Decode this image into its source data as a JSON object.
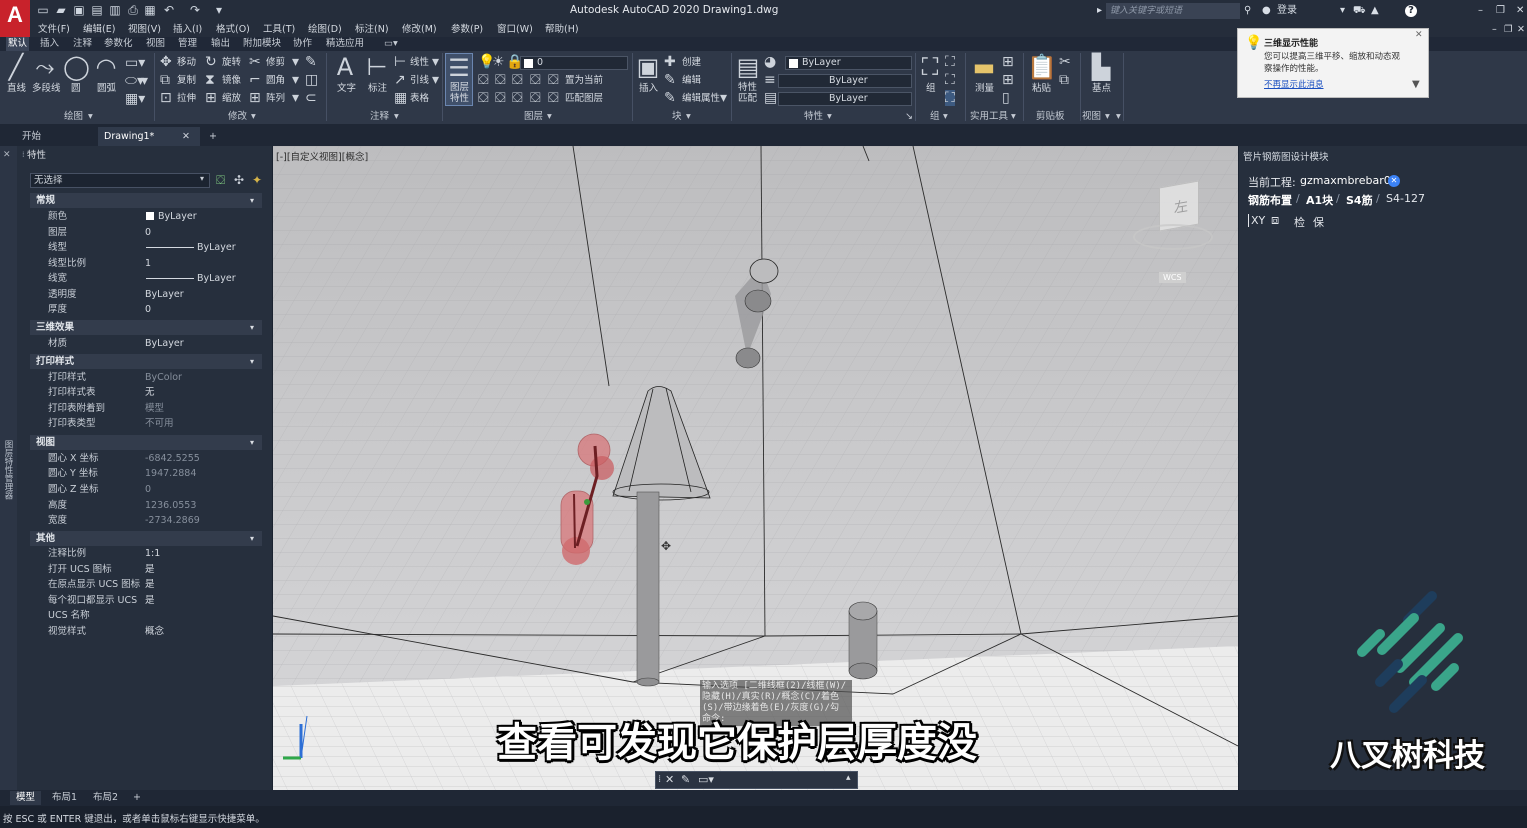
{
  "titlebar": {
    "logo": "A",
    "title": "Autodesk AutoCAD 2020    Drawing1.dwg",
    "search_placeholder": "键入关键字或短语",
    "login": "登录",
    "quick_icons": [
      "new-file-icon",
      "open-icon",
      "save-icon",
      "save-as-icon",
      "web-icon",
      "plot-icon",
      "undo-icon",
      "redo-icon"
    ],
    "window_controls": [
      "–",
      "❐",
      "✕"
    ]
  },
  "menubar": [
    "文件(F)",
    "编辑(E)",
    "视图(V)",
    "插入(I)",
    "格式(O)",
    "工具(T)",
    "绘图(D)",
    "标注(N)",
    "修改(M)",
    "参数(P)",
    "窗口(W)",
    "帮助(H)"
  ],
  "ribbon_tabs": [
    "默认",
    "插入",
    "注释",
    "参数化",
    "视图",
    "管理",
    "输出",
    "附加模块",
    "协作",
    "精选应用"
  ],
  "ribbon": {
    "draw": {
      "title": "绘图",
      "tools": [
        "直线",
        "多段线",
        "圆",
        "圆弧"
      ]
    },
    "modify": {
      "title": "修改",
      "tools": [
        "移动",
        "旋转",
        "修剪",
        "复制",
        "镜像",
        "圆角",
        "拉伸",
        "缩放",
        "阵列"
      ]
    },
    "annotation": {
      "title": "注释",
      "tools": [
        "文字",
        "标注",
        "线性",
        "引线",
        "表格"
      ]
    },
    "layers": {
      "title": "图层",
      "layer_props": "图层特性",
      "current_layer": "0",
      "tools": [
        "置为当前",
        "匹配图层"
      ]
    },
    "block": {
      "title": "块",
      "tools": [
        "插入",
        "创建",
        "编辑",
        "编辑属性"
      ]
    },
    "properties": {
      "title": "特性",
      "match": "特性匹配",
      "color": "ByLayer",
      "linetype": "ByLayer",
      "lineweight": "ByLayer"
    },
    "groups": {
      "title": "组",
      "tool": "组"
    },
    "utilities": {
      "title": "实用工具",
      "tool": "测量"
    },
    "clipboard": {
      "title": "剪贴板",
      "tool": "粘贴"
    },
    "view": {
      "title": "视图",
      "tool": "基点"
    }
  },
  "doc_tabs": {
    "start": "开始",
    "drawing": "Drawing1*",
    "close": "✕",
    "add": "+"
  },
  "properties_panel": {
    "header": "特性",
    "side_strip": "图层特性管理器",
    "selection": "无选择",
    "sections": [
      {
        "title": "常规",
        "rows": [
          {
            "label": "颜色",
            "value": "ByLayer"
          },
          {
            "label": "图层",
            "value": "0"
          },
          {
            "label": "线型",
            "value": "ByLayer"
          },
          {
            "label": "线型比例",
            "value": "1"
          },
          {
            "label": "线宽",
            "value": "ByLayer"
          },
          {
            "label": "透明度",
            "value": "ByLayer"
          },
          {
            "label": "厚度",
            "value": "0"
          }
        ]
      },
      {
        "title": "三维效果",
        "rows": [
          {
            "label": "材质",
            "value": "ByLayer"
          }
        ]
      },
      {
        "title": "打印样式",
        "rows": [
          {
            "label": "打印样式",
            "value": "ByColor"
          },
          {
            "label": "打印样式表",
            "value": "无"
          },
          {
            "label": "打印表附着到",
            "value": "模型"
          },
          {
            "label": "打印表类型",
            "value": "不可用"
          }
        ]
      },
      {
        "title": "视图",
        "rows": [
          {
            "label": "圆心 X 坐标",
            "value": "-6842.5255"
          },
          {
            "label": "圆心 Y 坐标",
            "value": "1947.2884"
          },
          {
            "label": "圆心 Z 坐标",
            "value": "0"
          },
          {
            "label": "高度",
            "value": "1236.0553"
          },
          {
            "label": "宽度",
            "value": "-2734.2869"
          }
        ]
      },
      {
        "title": "其他",
        "rows": [
          {
            "label": "注释比例",
            "value": "1:1"
          },
          {
            "label": "打开 UCS 图标",
            "value": "是"
          },
          {
            "label": "在原点显示 UCS 图标",
            "value": "是"
          },
          {
            "label": "每个视口都显示 UCS",
            "value": "是"
          },
          {
            "label": "UCS 名称",
            "value": ""
          },
          {
            "label": "视觉样式",
            "value": "概念"
          }
        ]
      }
    ]
  },
  "viewport": {
    "label": "[-][自定义视图][概念]",
    "viewcube_face": "左",
    "wcs_label": "WCS",
    "command_tip": [
      "输入选项 [二维线框(2)/线框(W)/",
      "隐藏(H)/真实(R)/概念(C)/着色",
      "(S)/带边缘着色(E)/灰度(G)/勾"
    ],
    "command_partial": "命令:"
  },
  "notification": {
    "title": "三维显示性能",
    "body": "您可以提高三维平移、缩放和动态观察操作的性能。",
    "link": "不再显示此消息"
  },
  "right_panel": {
    "header": "管片钢筋图设计模块",
    "project_label": "当前工程:",
    "project_name": "gzmaxmbrebar01",
    "breadcrumb": [
      "钢筋布置",
      "A1块",
      "S4筋",
      "S4-127"
    ],
    "toolbar": [
      "XY",
      "检",
      "保"
    ]
  },
  "layout_tabs": [
    "模型",
    "布局1",
    "布局2",
    "+"
  ],
  "status_text": "按 ESC 或 ENTER 键退出，或者单击鼠标右键显示快捷菜单。",
  "overlay": {
    "subtitle": "查看可发现它保护层厚度没",
    "brand": "八叉树科技",
    "brand_color": "#3aa58a"
  }
}
